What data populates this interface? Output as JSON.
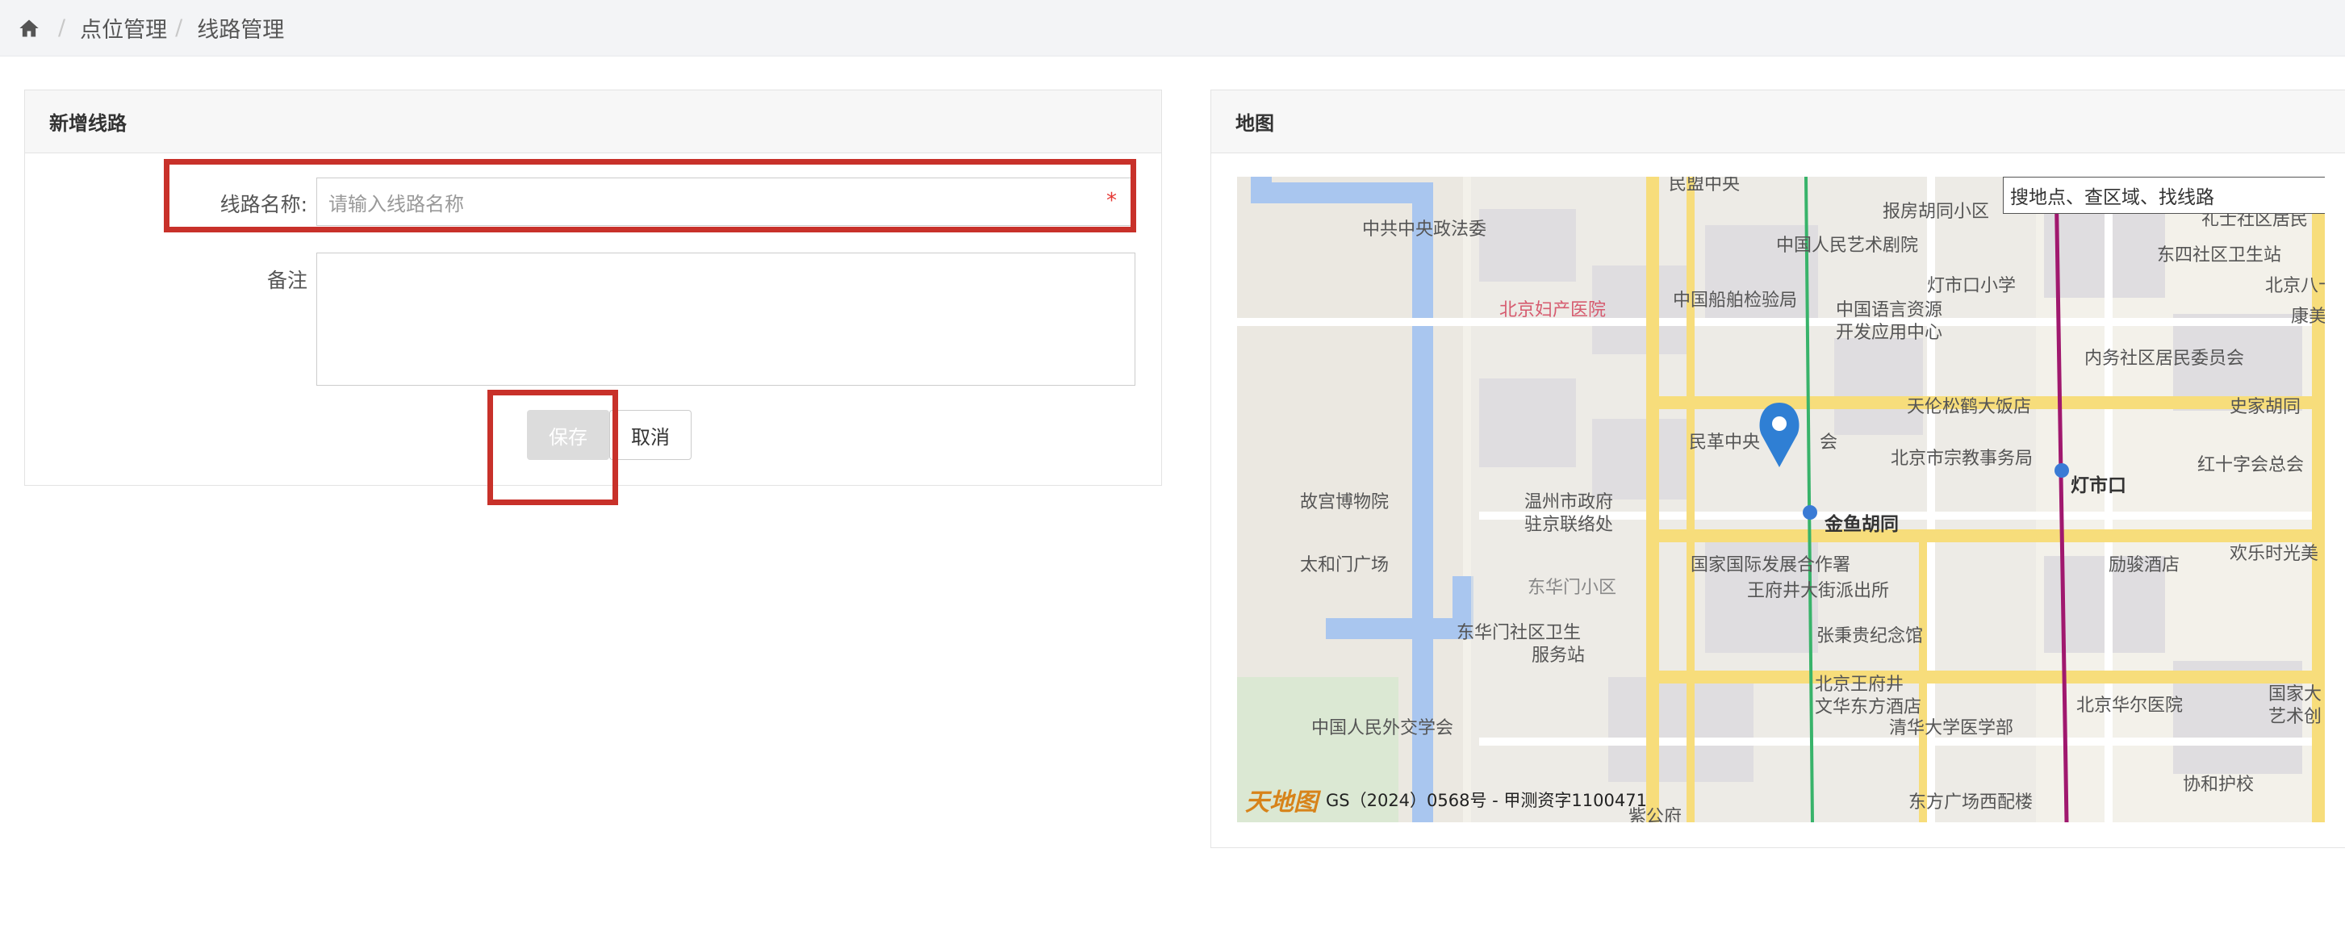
{
  "breadcrumb": {
    "home_icon": "home-icon",
    "sep": "/",
    "items": [
      "点位管理",
      "线路管理"
    ]
  },
  "form": {
    "title": "新增线路",
    "name_label": "线路名称:",
    "name_placeholder": "请输入线路名称",
    "required_mark": "*",
    "remark_label": "备注",
    "save_label": "保存",
    "cancel_label": "取消"
  },
  "map": {
    "title": "地图",
    "search_placeholder": "搜地点、查区域、找线路",
    "copyright_logo": "天地图",
    "copyright": "GS（2024）0568号 - 甲测资字1100471",
    "labels": [
      "民盟中央",
      "中共中央政法委",
      "报房胡同小区",
      "中国人民艺术剧院",
      "礼士社区居民",
      "东四社区卫生站",
      "北京八十",
      "康美",
      "灯市口小学",
      "中国船舶检验局",
      "中国语言资源",
      "开发应用中心",
      "北京妇产医院",
      "内务社区居民委员会",
      "史家胡同",
      "天伦松鹤大饭店",
      "民革中央",
      "会",
      "北京市宗教事务局",
      "红十字会总会",
      "灯市口",
      "故宫博物院",
      "温州市政府",
      "驻京联络处",
      "金鱼胡同",
      "欢乐时光美",
      "太和门广场",
      "国家国际发展合作署",
      "励骏酒店",
      "东华门小区",
      "王府井大街派出所",
      "东华门社区卫生",
      "服务站",
      "张秉贵纪念馆",
      "北京王府井",
      "文华东方酒店",
      "北京华尔医院",
      "国家大",
      "艺术创",
      "中国人民外交学会",
      "清华大学医学部",
      "协和护校",
      "东方广场西配楼",
      "紫公府"
    ]
  },
  "colors": {
    "accent": "#c8312a",
    "marker": "#2f7fd4"
  }
}
